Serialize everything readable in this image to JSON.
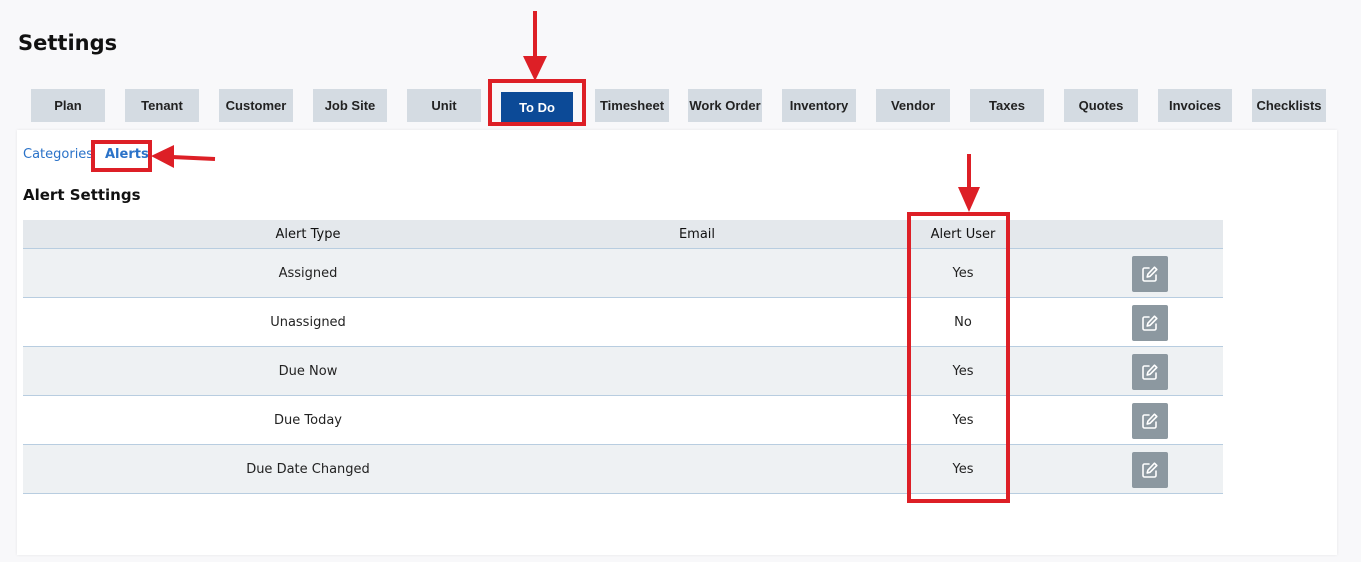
{
  "page": {
    "title": "Settings"
  },
  "tabs": [
    {
      "label": "Plan",
      "active": false
    },
    {
      "label": "Tenant",
      "active": false
    },
    {
      "label": "Customer",
      "active": false
    },
    {
      "label": "Job Site",
      "active": false
    },
    {
      "label": "Unit",
      "active": false
    },
    {
      "label": "To Do",
      "active": true
    },
    {
      "label": "Timesheet",
      "active": false
    },
    {
      "label": "Work Order",
      "active": false
    },
    {
      "label": "Inventory",
      "active": false
    },
    {
      "label": "Vendor",
      "active": false
    },
    {
      "label": "Taxes",
      "active": false
    },
    {
      "label": "Quotes",
      "active": false
    },
    {
      "label": "Invoices",
      "active": false
    },
    {
      "label": "Checklists",
      "active": false
    }
  ],
  "subnav": {
    "categories": "Categories",
    "alerts": "Alerts"
  },
  "section": {
    "title": "Alert Settings"
  },
  "table": {
    "headers": {
      "alert_type": "Alert Type",
      "email": "Email",
      "alert_user": "Alert User"
    },
    "rows": [
      {
        "alert_type": "Assigned",
        "email": "",
        "alert_user": "Yes"
      },
      {
        "alert_type": "Unassigned",
        "email": "",
        "alert_user": "No"
      },
      {
        "alert_type": "Due Now",
        "email": "",
        "alert_user": "Yes"
      },
      {
        "alert_type": "Due Today",
        "email": "",
        "alert_user": "Yes"
      },
      {
        "alert_type": "Due Date Changed",
        "email": "",
        "alert_user": "Yes"
      }
    ],
    "edit_icon": "edit-icon"
  },
  "colors": {
    "active_tab": "#0c4a97",
    "tab_bg": "#d4dbe2",
    "link": "#2a72c8",
    "annotation": "#dd1f26",
    "edit_button": "#8c98a0"
  }
}
